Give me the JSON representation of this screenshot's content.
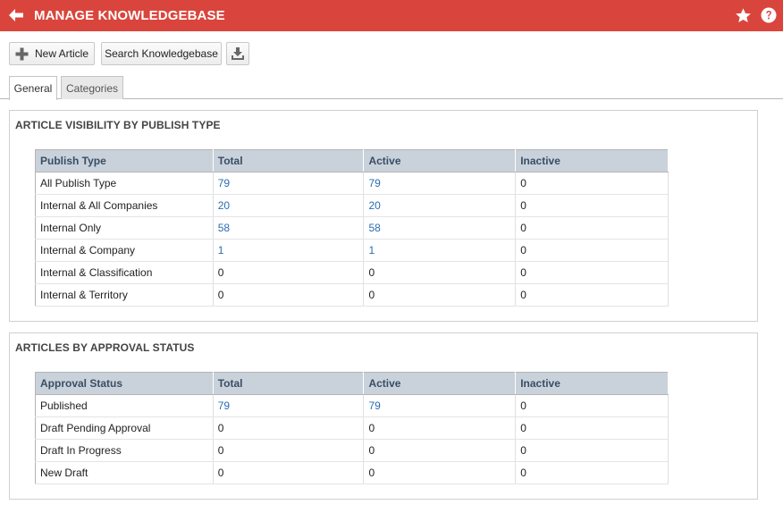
{
  "header": {
    "title": "MANAGE KNOWLEDGEBASE",
    "bg_color": "#d9453c"
  },
  "toolbar": {
    "new_article_label": "New Article",
    "search_label": "Search Knowledgebase"
  },
  "tabs": [
    {
      "label": "General",
      "active": true
    },
    {
      "label": "Categories",
      "active": false
    }
  ],
  "visibility": {
    "title": "ARTICLE VISIBILITY BY PUBLISH TYPE",
    "columns": [
      "Publish Type",
      "Total",
      "Active",
      "Inactive"
    ],
    "rows": [
      [
        "All Publish Type",
        "79",
        "79",
        "0"
      ],
      [
        "Internal & All Companies",
        "20",
        "20",
        "0"
      ],
      [
        "Internal Only",
        "58",
        "58",
        "0"
      ],
      [
        "Internal & Company",
        "1",
        "1",
        "0"
      ],
      [
        "Internal & Classification",
        "0",
        "0",
        "0"
      ],
      [
        "Internal & Territory",
        "0",
        "0",
        "0"
      ]
    ]
  },
  "approval": {
    "title": "ARTICLES BY APPROVAL STATUS",
    "columns": [
      "Approval Status",
      "Total",
      "Active",
      "Inactive"
    ],
    "rows": [
      [
        "Published",
        "79",
        "79",
        "0"
      ],
      [
        "Draft Pending Approval",
        "0",
        "0",
        "0"
      ],
      [
        "Draft In Progress",
        "0",
        "0",
        "0"
      ],
      [
        "New Draft",
        "0",
        "0",
        "0"
      ]
    ]
  },
  "colors": {
    "link": "#2a6db3",
    "table_header_bg": "#c9d2da"
  }
}
